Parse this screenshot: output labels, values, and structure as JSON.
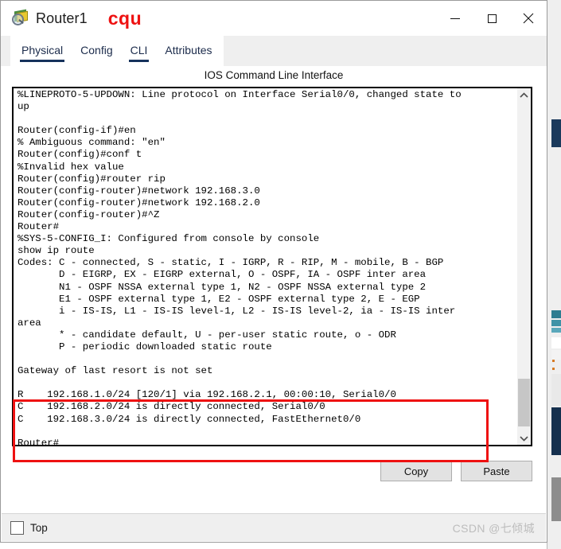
{
  "window": {
    "title": "Router1",
    "icon_name": "router-device-icon",
    "annotation": "cqu",
    "controls": {
      "minimize": "minimize-icon",
      "maximize": "maximize-icon",
      "close": "close-icon"
    }
  },
  "tabs": [
    {
      "label": "Physical",
      "selected": true
    },
    {
      "label": "Config",
      "selected": false
    },
    {
      "label": "CLI",
      "selected": true
    },
    {
      "label": "Attributes",
      "selected": false
    }
  ],
  "panel": {
    "heading": "IOS Command Line Interface"
  },
  "terminal": {
    "lines": [
      "%LINEPROTO-5-UPDOWN: Line protocol on Interface Serial0/0, changed state to",
      "up",
      "",
      "Router(config-if)#en",
      "% Ambiguous command: \"en\"",
      "Router(config)#conf t",
      "%Invalid hex value",
      "Router(config)#router rip",
      "Router(config-router)#network 192.168.3.0",
      "Router(config-router)#network 192.168.2.0",
      "Router(config-router)#^Z",
      "Router#",
      "%SYS-5-CONFIG_I: Configured from console by console",
      "show ip route",
      "Codes: C - connected, S - static, I - IGRP, R - RIP, M - mobile, B - BGP",
      "       D - EIGRP, EX - EIGRP external, O - OSPF, IA - OSPF inter area",
      "       N1 - OSPF NSSA external type 1, N2 - OSPF NSSA external type 2",
      "       E1 - OSPF external type 1, E2 - OSPF external type 2, E - EGP",
      "       i - IS-IS, L1 - IS-IS level-1, L2 - IS-IS level-2, ia - IS-IS inter",
      "area",
      "       * - candidate default, U - per-user static route, o - ODR",
      "       P - periodic downloaded static route",
      "",
      "Gateway of last resort is not set",
      "",
      "R    192.168.1.0/24 [120/1] via 192.168.2.1, 00:00:10, Serial0/0",
      "C    192.168.2.0/24 is directly connected, Serial0/0",
      "C    192.168.3.0/24 is directly connected, FastEthernet0/0",
      "",
      "Router#"
    ]
  },
  "scrollbar": {
    "up_arrow": "chevron-up-icon",
    "down_arrow": "chevron-down-icon"
  },
  "buttons": {
    "copy": "Copy",
    "paste": "Paste"
  },
  "statusbar": {
    "top_checkbox_label": "Top",
    "top_checked": false,
    "watermark": "CSDN @七倾城"
  },
  "colors": {
    "annotation_red": "#ee1111",
    "tab_text": "#1b2b4b",
    "tab_underline": "#16325c"
  }
}
